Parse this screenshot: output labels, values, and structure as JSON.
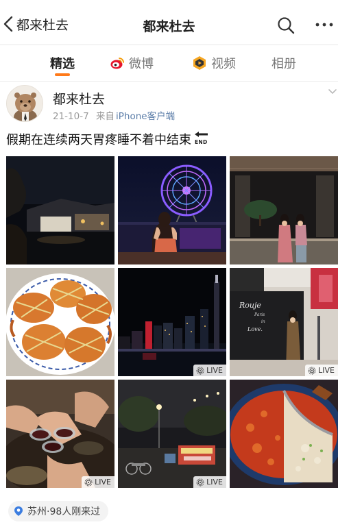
{
  "nav": {
    "back_label": "都来杜去",
    "title": "都来杜去"
  },
  "tabs": [
    {
      "label": "精选",
      "active": true
    },
    {
      "label": "微博",
      "active": false
    },
    {
      "label": "视频",
      "active": false
    },
    {
      "label": "相册",
      "active": false
    }
  ],
  "post": {
    "author": "都来杜去",
    "date": "21-10-7",
    "source_prefix": "来自",
    "source": "iPhone客户端",
    "text": "假期在连续两天胃疼睡不着中结束",
    "end_label": "END"
  },
  "photos": [
    {
      "name": "night-garden",
      "live": false
    },
    {
      "name": "ferris-wheel",
      "live": false
    },
    {
      "name": "two-women-lobby",
      "live": false
    },
    {
      "name": "crabs-plate",
      "live": false
    },
    {
      "name": "city-skyline",
      "live": true,
      "live_label": "LIVE"
    },
    {
      "name": "rouje-store",
      "live": true,
      "live_label": "LIVE"
    },
    {
      "name": "toast-cups",
      "live": true,
      "live_label": "LIVE"
    },
    {
      "name": "night-street",
      "live": true,
      "live_label": "LIVE"
    },
    {
      "name": "hotpot",
      "live": false
    }
  ],
  "location": {
    "label": "苏州·98人刚来过"
  },
  "colors": {
    "accent": "#ff7a1a",
    "link": "#5b7da8",
    "location_pin": "#3b7de0"
  }
}
